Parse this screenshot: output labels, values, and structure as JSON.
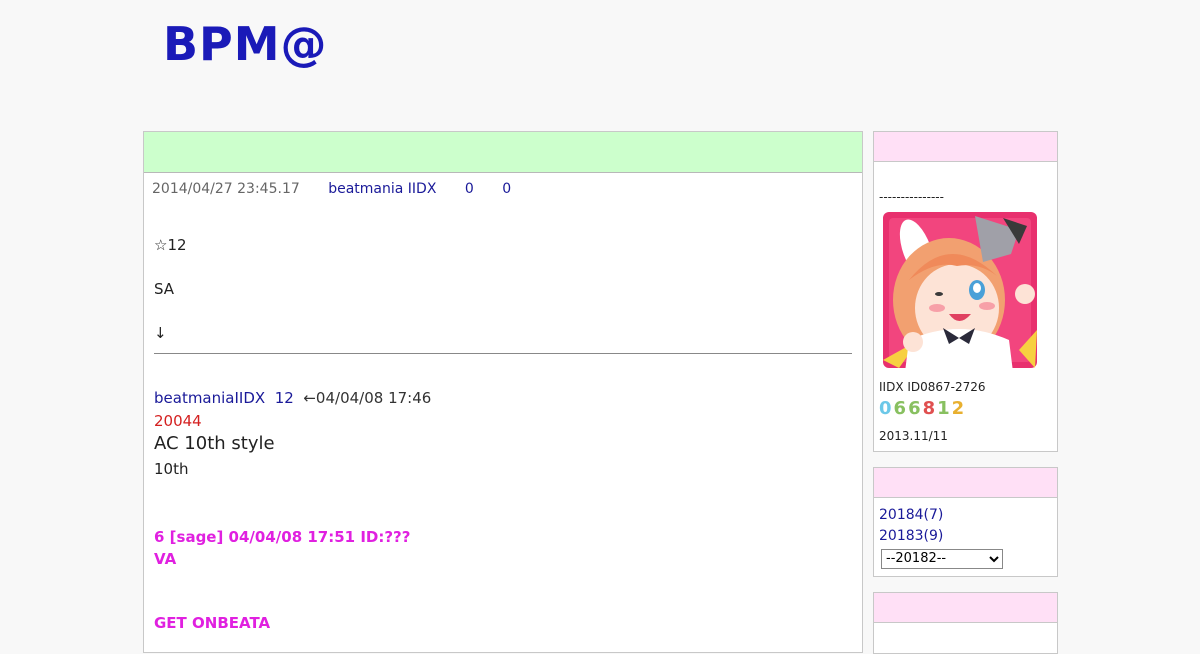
{
  "site": {
    "title": "BPM@"
  },
  "entry": {
    "date": "2014/04/27 23:45.17",
    "category": "beatmania IIDX",
    "comments": "0",
    "trackbacks": "0",
    "lines": [
      "☆12",
      "SA",
      "↓"
    ]
  },
  "quote": {
    "name": "beatmaniaIIDX",
    "num": "12",
    "timestamp": "←04/04/08 17:46",
    "red_line": "20044",
    "big_line": "AC 10th style",
    "small_line": "10th",
    "reply_head": "6  [sage] 04/04/08 17:51 ID:???",
    "reply_line": "VA",
    "bottom_line": "GET ONBEATA"
  },
  "sidebar": {
    "profile": {
      "dashes": "---------------",
      "iidx_id": "IIDX ID0867-2726",
      "counter": [
        "0",
        "6",
        "6",
        "8",
        "1",
        "2"
      ],
      "counter_colors": [
        "#6cc8e8",
        "#88c060",
        "#88c060",
        "#e05050",
        "#88c060",
        "#e8b030"
      ],
      "since": "2013.11/11"
    },
    "archive": {
      "items": [
        "20184(7)",
        "20183(9)"
      ],
      "select_value": "--20182--"
    }
  }
}
